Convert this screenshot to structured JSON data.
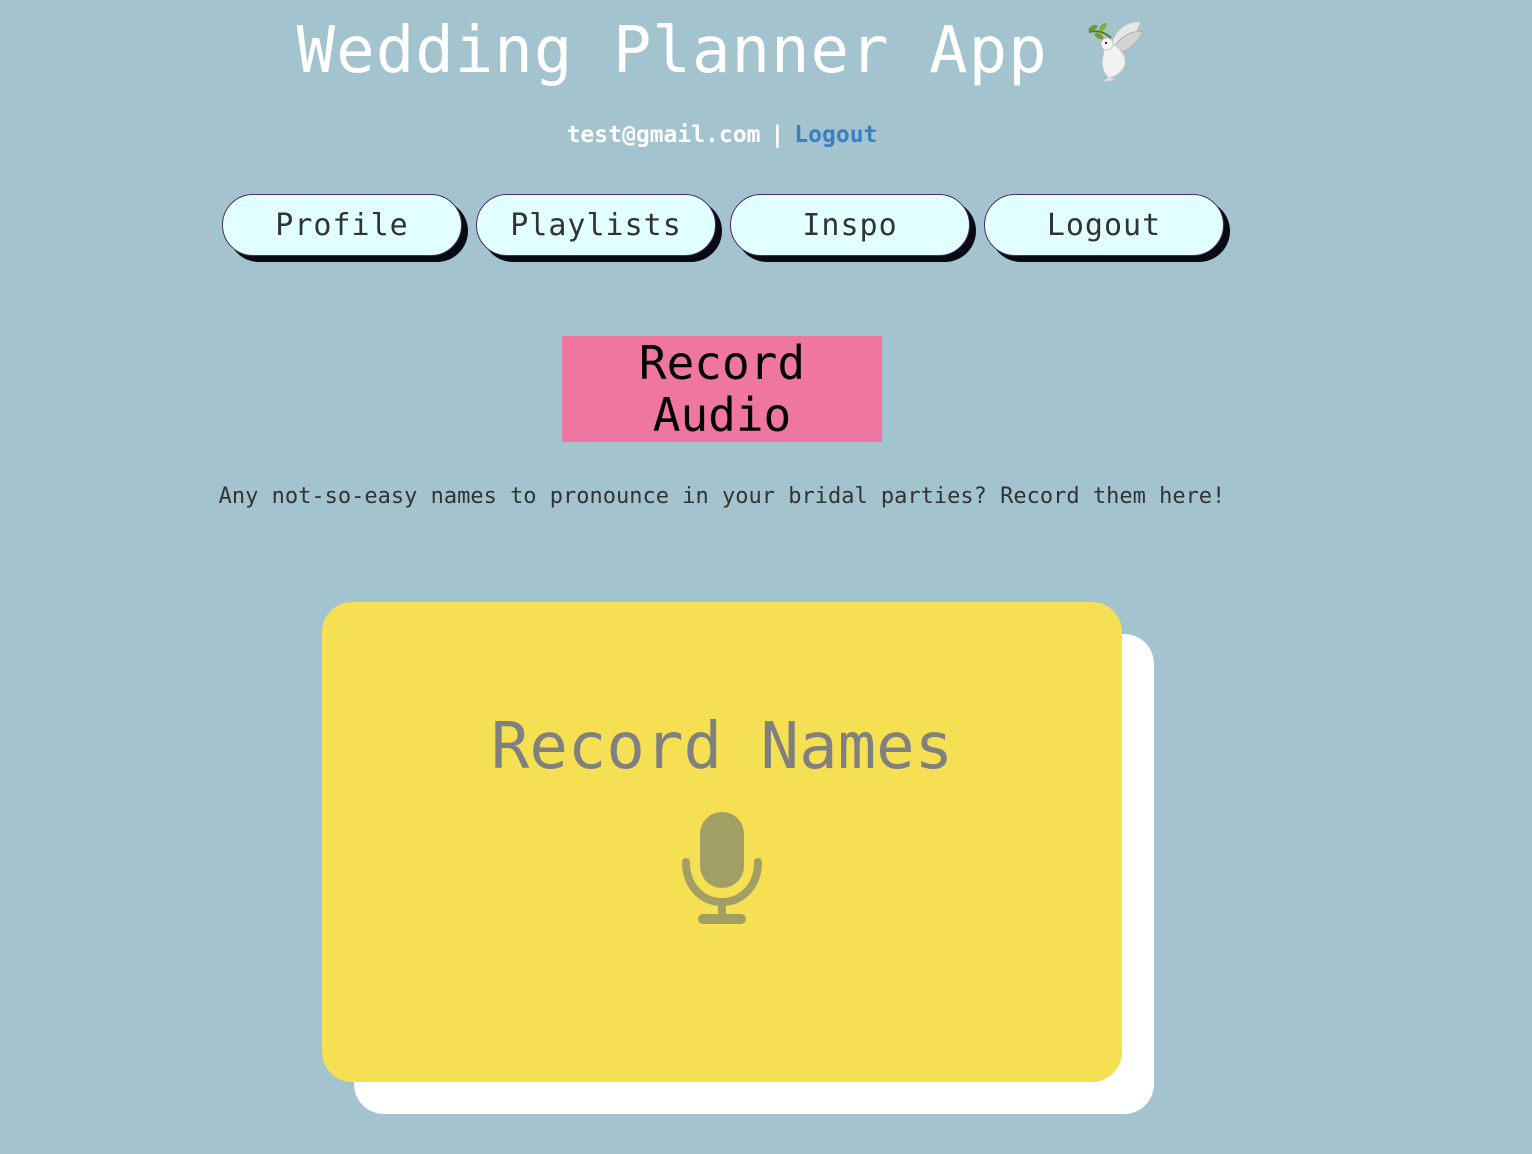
{
  "header": {
    "title": "Wedding Planner App",
    "title_icon": "dove-icon",
    "user_email": "test@gmail.com",
    "separator": "|",
    "logout_link": "Logout"
  },
  "nav": {
    "items": [
      {
        "label": "Profile"
      },
      {
        "label": "Playlists"
      },
      {
        "label": "Inspo"
      },
      {
        "label": "Logout"
      }
    ]
  },
  "main": {
    "record_audio_button": "Record Audio",
    "description": "Any not-so-easy names to pronounce in your bridal parties? Record them here!",
    "card": {
      "title": "Record Names",
      "icon": "microphone-icon"
    }
  },
  "colors": {
    "background": "#a3c4cf",
    "nav_button": "#e2ffff",
    "record_audio": "#ef769e",
    "card": "#f5df52",
    "link": "#3a7fc4"
  }
}
